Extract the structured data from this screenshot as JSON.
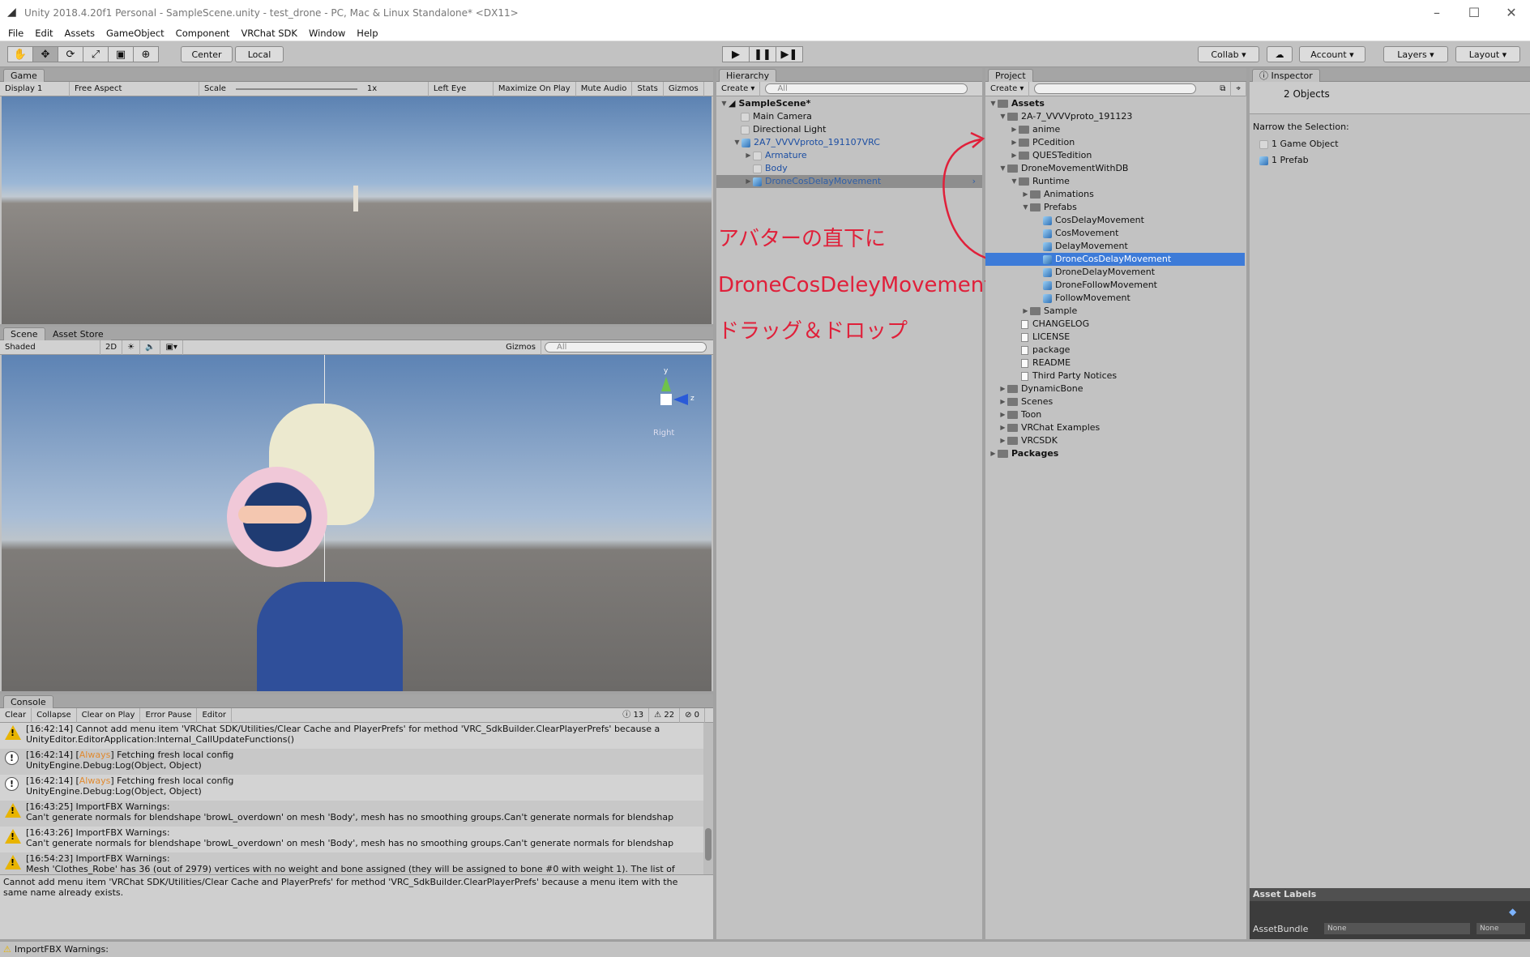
{
  "window": {
    "title": "Unity 2018.4.20f1 Personal - SampleScene.unity - test_drone - PC, Mac & Linux Standalone* <DX11>"
  },
  "menu": [
    "File",
    "Edit",
    "Assets",
    "GameObject",
    "Component",
    "VRChat SDK",
    "Window",
    "Help"
  ],
  "toolbar": {
    "center": "Center",
    "local": "Local",
    "collab": "Collab",
    "account": "Account",
    "layers": "Layers",
    "layout": "Layout"
  },
  "game": {
    "tab": "Game",
    "display": "Display 1",
    "aspect": "Free Aspect",
    "scale_label": "Scale",
    "scale_value": "1x",
    "left_eye": "Left Eye",
    "maximize": "Maximize On Play",
    "mute": "Mute Audio",
    "stats": "Stats",
    "gizmos": "Gizmos"
  },
  "scene": {
    "tab": "Scene",
    "tab2": "Asset Store",
    "shaded": "Shaded",
    "mode2d": "2D",
    "gizmos": "Gizmos",
    "search_placeholder": "All",
    "gizmo_y": "y",
    "gizmo_z": "z",
    "gizmo_view": "Right"
  },
  "hierarchy": {
    "tab": "Hierarchy",
    "create": "Create",
    "search_placeholder": "All",
    "scene": "SampleScene*",
    "items": [
      "Main Camera",
      "Directional Light",
      "2A7_VVVVproto_191107VRC",
      "Armature",
      "Body",
      "DroneCosDelayMovement"
    ]
  },
  "project": {
    "tab": "Project",
    "create": "Create",
    "items": [
      "Assets",
      "2A-7_VVVVproto_191123",
      "anime",
      "PCedition",
      "QUESTedition",
      "DroneMovementWithDB",
      "Runtime",
      "Animations",
      "Prefabs",
      "CosDelayMovement",
      "CosMovement",
      "DelayMovement",
      "DroneCosDelayMovement",
      "DroneDelayMovement",
      "DroneFollowMovement",
      "FollowMovement",
      "Sample",
      "CHANGELOG",
      "LICENSE",
      "package",
      "README",
      "Third Party Notices",
      "DynamicBone",
      "Scenes",
      "Toon",
      "VRChat Examples",
      "VRCSDK",
      "Packages"
    ]
  },
  "inspector": {
    "tab": "Inspector",
    "objects": "2 Objects",
    "narrow": "Narrow the Selection:",
    "game_object": "1 Game Object",
    "prefab": "1 Prefab",
    "asset_labels": "Asset Labels",
    "asset_bundle": "AssetBundle",
    "none1": "None",
    "none2": "None"
  },
  "annotation": [
    "アバターの直下に",
    "DroneCosDeleyMovementを",
    "ドラッグ＆ドロップ"
  ],
  "console": {
    "tab": "Console",
    "clear": "Clear",
    "collapse": "Collapse",
    "clear_on_play": "Clear on Play",
    "error_pause": "Error Pause",
    "editor": "Editor",
    "count_info": "13",
    "count_warn": "22",
    "count_err": "0",
    "entries": [
      {
        "type": "warn",
        "l1": "[16:42:14] Cannot add menu item 'VRChat SDK/Utilities/Clear Cache and PlayerPrefs' for method 'VRC_SdkBuilder.ClearPlayerPrefs' because a",
        "l2": "UnityEditor.EditorApplication:Internal_CallUpdateFunctions()"
      },
      {
        "type": "info",
        "l1a": "[16:42:14] [",
        "tag": "Always",
        "l1b": "] Fetching fresh local config",
        "l2": "UnityEngine.Debug:Log(Object, Object)"
      },
      {
        "type": "info",
        "l1a": "[16:42:14] [",
        "tag": "Always",
        "l1b": "] Fetching fresh local config",
        "l2": "UnityEngine.Debug:Log(Object, Object)"
      },
      {
        "type": "warn",
        "l1": "[16:43:25] ImportFBX Warnings:",
        "l2": "Can't generate normals for blendshape 'browL_overdown' on mesh 'Body', mesh has no smoothing groups.Can't generate normals for blendshap"
      },
      {
        "type": "warn",
        "l1": "[16:43:26] ImportFBX Warnings:",
        "l2": "Can't generate normals for blendshape 'browL_overdown' on mesh 'Body', mesh has no smoothing groups.Can't generate normals for blendshap"
      },
      {
        "type": "warn",
        "l1": "[16:54:23] ImportFBX Warnings:",
        "l2": "Mesh 'Clothes_Robe' has 36 (out of 2979) vertices with no weight and bone assigned (they will be assigned to bone #0 with weight 1). The list of"
      }
    ],
    "detail1": "Cannot add menu item 'VRChat SDK/Utilities/Clear Cache and PlayerPrefs' for method 'VRC_SdkBuilder.ClearPlayerPrefs' because a menu item with the",
    "detail2": "same name already exists."
  },
  "statusbar": {
    "text": "ImportFBX Warnings:"
  }
}
